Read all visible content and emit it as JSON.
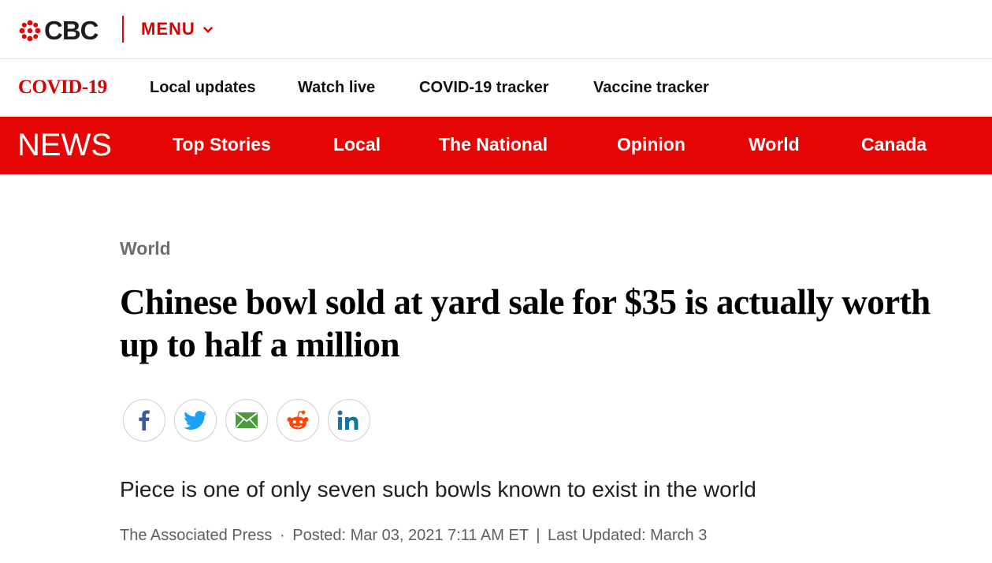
{
  "header": {
    "logo_text": "CBC",
    "menu_label": "MENU"
  },
  "covid_bar": {
    "title": "COVID-19",
    "links": [
      "Local updates",
      "Watch live",
      "COVID-19 tracker",
      "Vaccine tracker"
    ]
  },
  "news_bar": {
    "title": "NEWS",
    "links": [
      "Top Stories",
      "Local",
      "The National",
      "Opinion",
      "World",
      "Canada"
    ]
  },
  "article": {
    "section": "World",
    "headline": "Chinese bowl sold at yard sale for $35 is actually worth up to half a million",
    "dek": "Piece is one of only seven such bowls known to exist in the world",
    "author": "The Associated Press",
    "dot": "·",
    "posted": "Posted: Mar 03, 2021 7:11 AM ET",
    "pipe": "|",
    "updated": "Last Updated: March 3"
  },
  "share_icons": [
    "facebook-icon",
    "twitter-icon",
    "email-icon",
    "reddit-icon",
    "linkedin-icon"
  ],
  "colors": {
    "brand_red": "#e60505",
    "text_red": "#d50202",
    "facebook": "#3b5998",
    "twitter": "#1da1f2",
    "email": "#4a9a3a",
    "reddit": "#ff4500",
    "linkedin": "#0e76a8"
  }
}
